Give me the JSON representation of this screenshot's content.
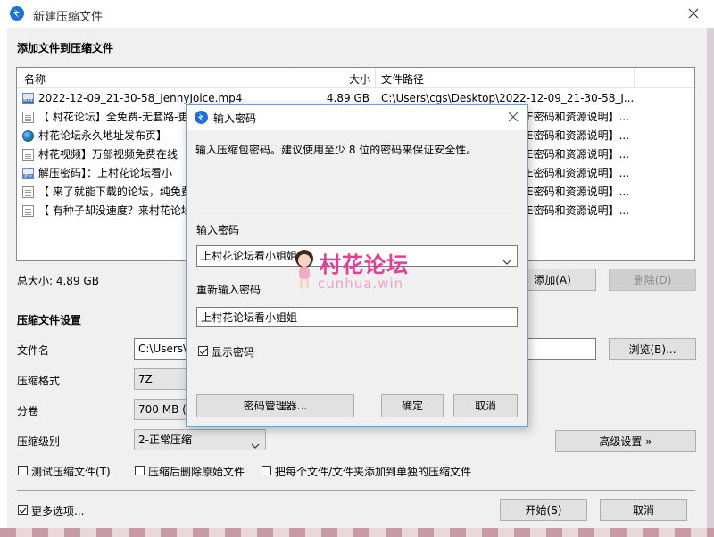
{
  "window": {
    "title": "新建压缩文件",
    "section_add": "添加文件到压缩文件"
  },
  "file_list": {
    "headers": {
      "name": "名称",
      "size": "大小",
      "path": "文件路径"
    },
    "rows": [
      {
        "icon": "mp4-file-icon",
        "name": "2022-12-09_21-30-58_JennyJoice.mp4",
        "size": "4.89 GB",
        "path": "C:\\Users\\cgs\\Desktop\\2022-12-09_21-30-58_J..."
      },
      {
        "icon": "document-icon",
        "name": "【 村花论坛】全免费-无套路-更",
        "size": "",
        "path": "E密码和资源说明】..."
      },
      {
        "icon": "globe-icon",
        "name": "村花论坛永久地址发布页】-",
        "size": "",
        "path": "E密码和资源说明】..."
      },
      {
        "icon": "document-icon",
        "name": "村花视频】万部视频免费在线",
        "size": "",
        "path": "E密码和资源说明】..."
      },
      {
        "icon": "jpg-file-icon",
        "name": "解压密码】：上村花论坛看小",
        "size": "",
        "path": "E密码和资源说明】..."
      },
      {
        "icon": "document-icon",
        "name": "【 来了就能下载的论坛，纯免费",
        "size": "",
        "path": "E密码和资源说明】..."
      },
      {
        "icon": "document-icon",
        "name": "【 有种子却没速度？来村花论坛",
        "size": "",
        "path": "E密码和资源说明】..."
      }
    ]
  },
  "total_size": "总大小: 4.89 GB",
  "buttons": {
    "add": "添加(A)",
    "delete": "删除(D)",
    "browse": "浏览(B)...",
    "advanced": "高级设置 »",
    "start": "开始(S)",
    "cancel": "取消"
  },
  "settings": {
    "heading": "压缩文件设置",
    "filename_label": "文件名",
    "filename_value": "C:\\Users\\",
    "format_label": "压缩格式",
    "format_value": "7Z",
    "volume_label": "分卷",
    "volume_value": "700 MB (",
    "level_label": "压缩级别",
    "level_value": "2-正常压缩",
    "chk_test": "测试压缩文件(T)",
    "chk_delete": "压缩后删除原始文件",
    "chk_each": "把每个文件/文件夹添加到单独的压缩文件",
    "chk_more": "更多选项..."
  },
  "password_dialog": {
    "title": "输入密码",
    "info": "输入压缩包密码。建议使用至少 8 位的密码来保证安全性。",
    "password_label": "输入密码",
    "password_value": "上村花论坛看小姐姐",
    "reenter_label": "重新输入密码",
    "reenter_value": "上村花论坛看小姐姐",
    "show_password": "显示密码",
    "manager_button": "密码管理器...",
    "ok_button": "确定",
    "cancel_button": "取消"
  },
  "watermark": {
    "cn": "村花论坛",
    "en": "cunhua.win"
  },
  "colors": {
    "app_icon": "#1e6fd9",
    "watermark": "#e0409a",
    "disabled_text": "#8a8a8a"
  }
}
